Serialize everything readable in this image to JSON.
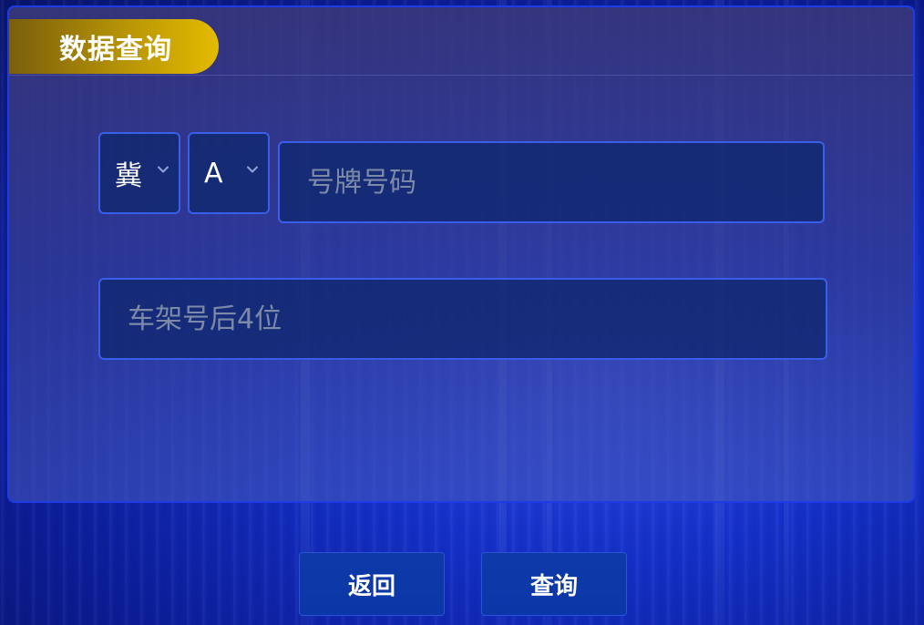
{
  "panel": {
    "title": "数据查询"
  },
  "form": {
    "province": {
      "value": "冀",
      "icon": "chevron-down-icon"
    },
    "letter": {
      "value": "A",
      "icon": "chevron-down-icon"
    },
    "plate_number": {
      "value": "",
      "placeholder": "号牌号码"
    },
    "vin_last4": {
      "value": "",
      "placeholder": "车架号后4位"
    }
  },
  "actions": {
    "back_label": "返回",
    "query_label": "查询"
  },
  "colors": {
    "accent_gold": "#e4bb00",
    "panel_border": "#1f3be6",
    "input_border": "#3b5ee8",
    "button_bg": "#0b36a8",
    "placeholder": "#7c8aa8"
  }
}
